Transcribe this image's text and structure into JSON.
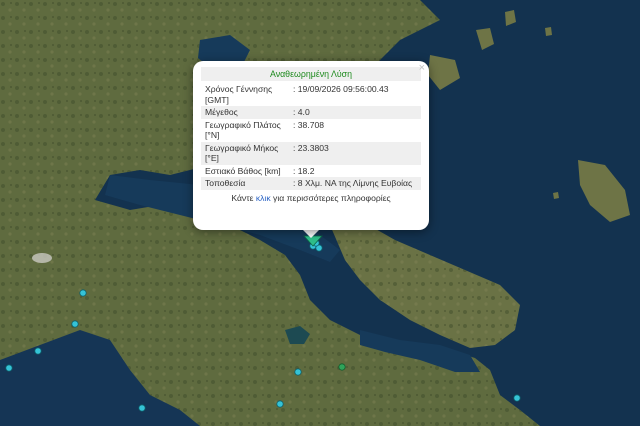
{
  "popup": {
    "title": "Αναθεωρημένη Λύση",
    "close_label": "×",
    "rows": [
      {
        "label": "Χρόνος Γέννησης [GMT]",
        "value": ": 19/09/2026 09:56:00.43"
      },
      {
        "label": "Μέγεθος",
        "value": ": 4.0"
      },
      {
        "label": "Γεωγραφικό Πλάτος [°N]",
        "value": ": 38.708"
      },
      {
        "label": "Γεωγραφικό Μήκος [°E]",
        "value": ": 23.3803"
      },
      {
        "label": "Εστιακό Βάθος [km]",
        "value": ": 18.2"
      },
      {
        "label": "Τοποθεσία",
        "value": ": 8 Χλμ. ΝΑ της Λίμνης Ευβοίας"
      }
    ],
    "more_prefix": "Κάντε ",
    "more_link": "κλικ",
    "more_suffix": " για περισσότερες πληροφορίες"
  },
  "colors": {
    "sea": "#13324f",
    "land": "#5b6a3c",
    "marker_cyan": "#35c3d6",
    "marker_green": "#2fa35a",
    "selected_marker": "#2fbf8a"
  }
}
